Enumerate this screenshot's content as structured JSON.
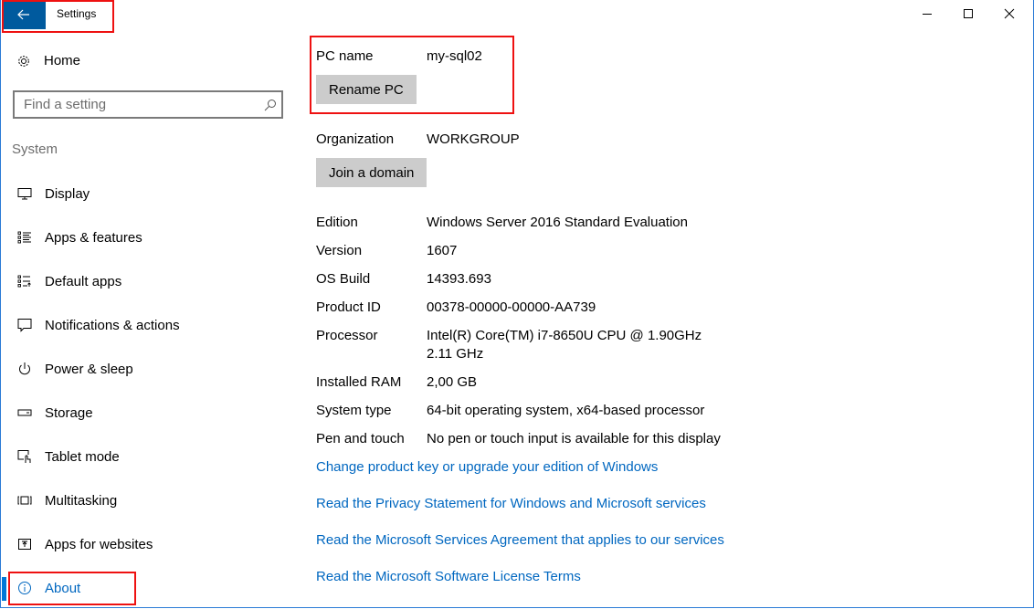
{
  "window": {
    "title": "Settings",
    "controls": {
      "minimize": "minimize-icon",
      "maximize": "maximize-icon",
      "close": "close-icon"
    },
    "accent_color": "#0078d7",
    "highlight_color": "#ee1111"
  },
  "sidebar": {
    "home_label": "Home",
    "search_placeholder": "Find a setting",
    "search_value": "",
    "section_label": "System",
    "items": [
      {
        "label": "Display",
        "icon": "display-icon",
        "active": false
      },
      {
        "label": "Apps & features",
        "icon": "apps-features-icon",
        "active": false
      },
      {
        "label": "Default apps",
        "icon": "default-apps-icon",
        "active": false
      },
      {
        "label": "Notifications & actions",
        "icon": "notifications-icon",
        "active": false
      },
      {
        "label": "Power & sleep",
        "icon": "power-icon",
        "active": false
      },
      {
        "label": "Storage",
        "icon": "storage-icon",
        "active": false
      },
      {
        "label": "Tablet mode",
        "icon": "tablet-mode-icon",
        "active": false
      },
      {
        "label": "Multitasking",
        "icon": "multitasking-icon",
        "active": false
      },
      {
        "label": "Apps for websites",
        "icon": "apps-for-websites-icon",
        "active": false
      },
      {
        "label": "About",
        "icon": "info-icon",
        "active": true
      }
    ]
  },
  "main": {
    "pc_name": {
      "label": "PC name",
      "value": "my-sql02",
      "button": "Rename PC"
    },
    "organization": {
      "label": "Organization",
      "value": "WORKGROUP",
      "button": "Join a domain"
    },
    "specs": [
      {
        "label": "Edition",
        "value": "Windows Server 2016 Standard Evaluation"
      },
      {
        "label": "Version",
        "value": "1607"
      },
      {
        "label": "OS Build",
        "value": "14393.693"
      },
      {
        "label": "Product ID",
        "value": "00378-00000-00000-AA739"
      },
      {
        "label": "Processor",
        "value": "Intel(R) Core(TM) i7-8650U CPU @ 1.90GHz   2.11 GHz"
      },
      {
        "label": "Installed RAM",
        "value": "2,00 GB"
      },
      {
        "label": "System type",
        "value": "64-bit operating system, x64-based processor"
      },
      {
        "label": "Pen and touch",
        "value": "No pen or touch input is available for this display"
      }
    ],
    "links": [
      "Change product key or upgrade your edition of Windows",
      "Read the Privacy Statement for Windows and Microsoft services",
      "Read the Microsoft Services Agreement that applies to our services",
      "Read the Microsoft Software License Terms"
    ]
  }
}
